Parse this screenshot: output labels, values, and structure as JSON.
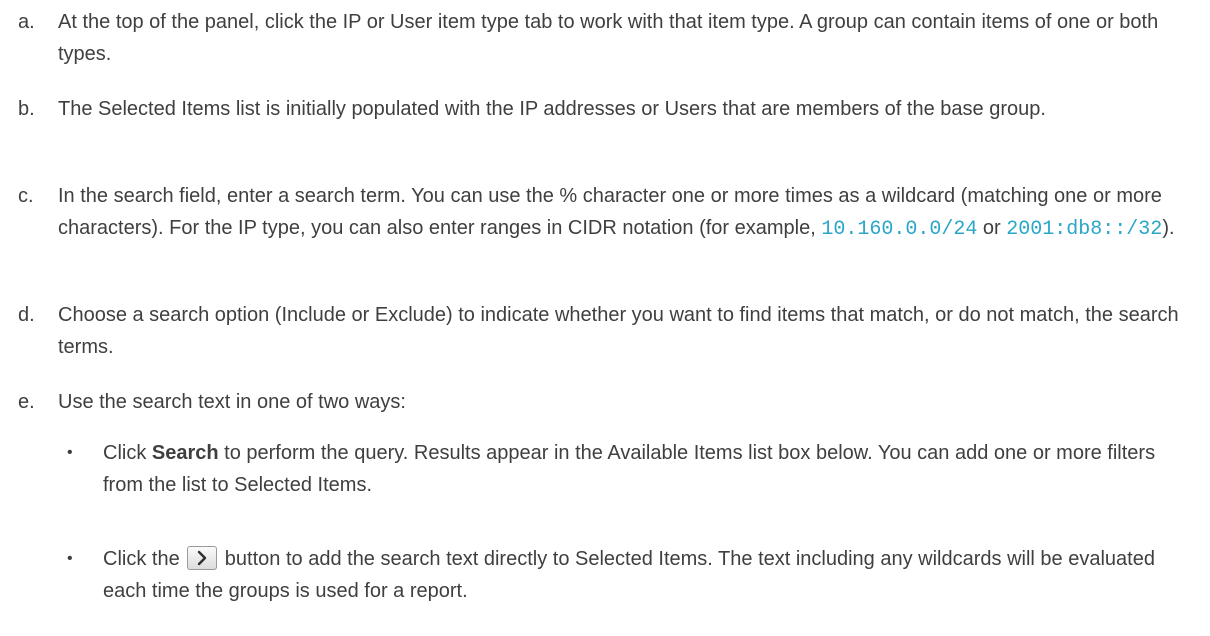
{
  "items": [
    {
      "marker": "a.",
      "text": "At the top of the panel, click the IP or User item type tab to work with that item type. A group can contain items of one or both types."
    },
    {
      "marker": "b.",
      "text": "The Selected Items list is initially populated with the IP addresses or Users that are members of the base group."
    },
    {
      "marker": "c.",
      "text_before": "In the search field, enter a search term. You can use the % character one or more times as a wildcard (matching one or more characters). For the IP type, you can also enter ranges in CIDR notation (for example, ",
      "code1": "10.160.0.0/24",
      "text_or": " or ",
      "code2": "2001:db8::/32",
      "text_after": ")."
    },
    {
      "marker": "d.",
      "text": "Choose a search option (Include or Exclude) to indicate whether you want to find items that match, or do not match, the search terms."
    },
    {
      "marker": "e.",
      "text": "Use the search text in one of two ways:"
    }
  ],
  "subitems": [
    {
      "bullet": "•",
      "text_before": "Click ",
      "bold": "Search",
      "text_after": " to perform the query. Results appear in the Available Items list box below. You can add one or more filters from the list to Selected Items."
    },
    {
      "bullet": "•",
      "text_before": "Click the ",
      "icon": "chevron-right-icon",
      "text_after": " button to add the search text directly to Selected Items. The text including any wildcards will be evaluated each time the groups is used for a report."
    }
  ],
  "colors": {
    "text": "#3f3f3f",
    "code": "#29a6c8"
  }
}
